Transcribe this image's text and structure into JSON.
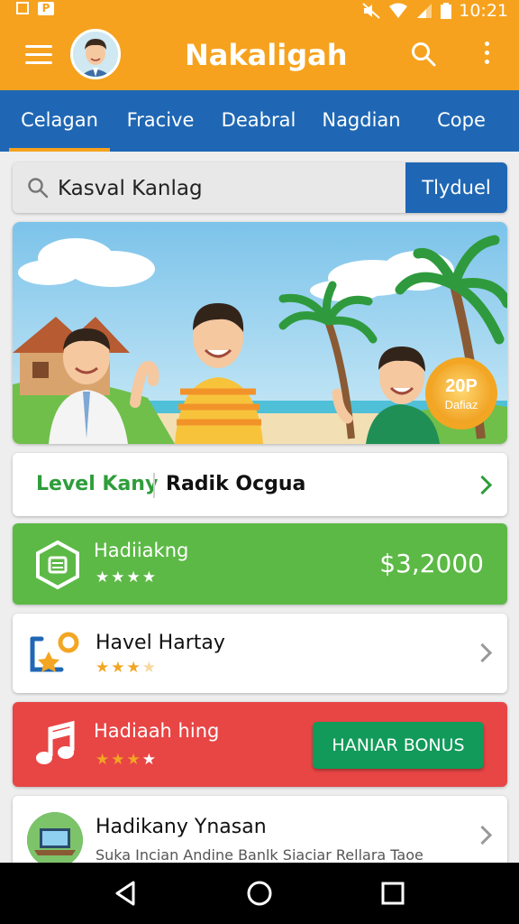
{
  "status_bar": {
    "time": "10:21"
  },
  "app_bar": {
    "title": "Nakaligah"
  },
  "tabs": [
    {
      "label": "Celagan",
      "active": true
    },
    {
      "label": "Fracive"
    },
    {
      "label": "Deabral"
    },
    {
      "label": "Nagdian"
    },
    {
      "label": "Cope"
    }
  ],
  "search": {
    "value": "Kasval Kanlag",
    "button_label": "Tlyduel"
  },
  "banner": {
    "badge_line1": "20P",
    "badge_line2": "Dafiaz"
  },
  "level_card": {
    "label": "Level Kany",
    "value": "Radik Ocgua"
  },
  "reward_card": {
    "title": "Hadiiakng",
    "rating": 4,
    "amount": "$3,2000"
  },
  "item_card": {
    "title": "Havel Hartay",
    "rating": 3.5
  },
  "bonus_card": {
    "title": "Hadiaah hing",
    "rating": 4,
    "button_label": "HANIAR BONUS"
  },
  "last_card": {
    "title": "Hadikany Ynasan",
    "subtitle": "Suka Incian Andine Banlk Siaciar Rellara Taoe"
  },
  "colors": {
    "primary": "#f6a21e",
    "tab_bar": "#1f67b4",
    "green": "#5cb946",
    "red": "#e84545",
    "bonus_button": "#119a5a"
  }
}
